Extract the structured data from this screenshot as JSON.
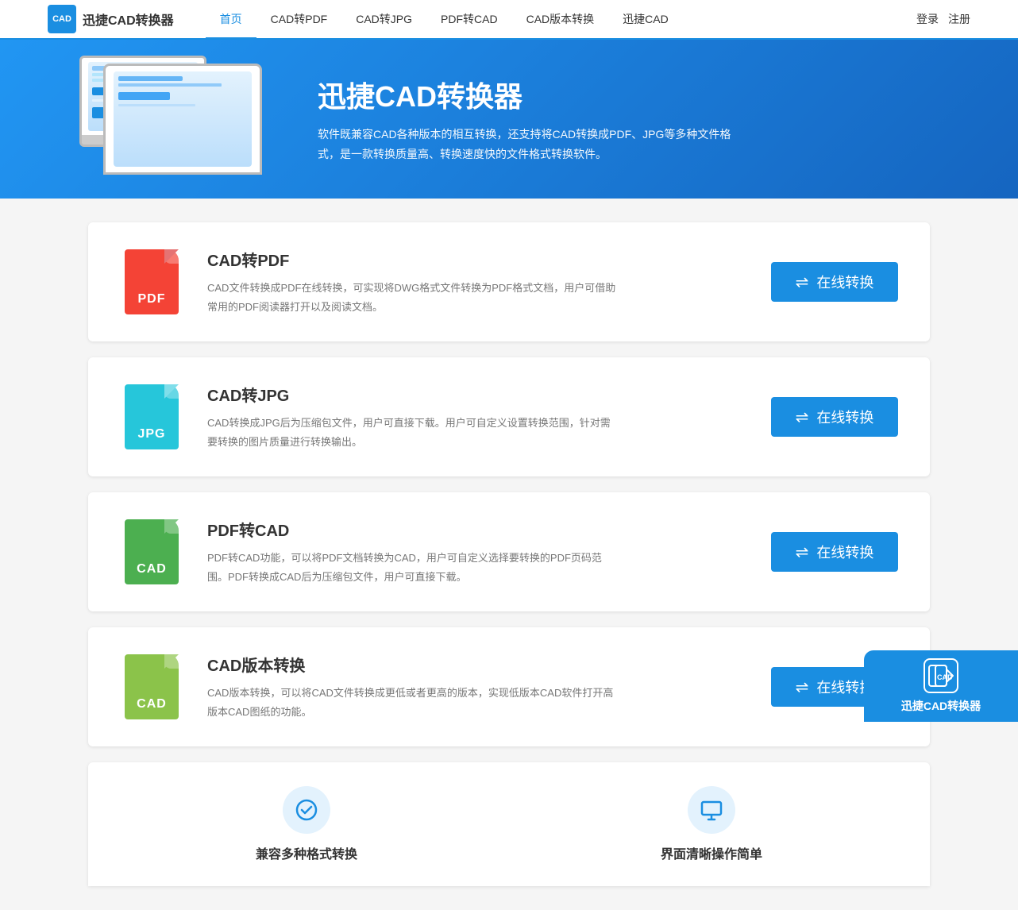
{
  "nav": {
    "logo_icon": "CAD",
    "logo_text": "迅捷CAD转换器",
    "items": [
      {
        "label": "首页",
        "active": true
      },
      {
        "label": "CAD转PDF",
        "active": false
      },
      {
        "label": "CAD转JPG",
        "active": false
      },
      {
        "label": "PDF转CAD",
        "active": false
      },
      {
        "label": "CAD版本转换",
        "active": false
      },
      {
        "label": "迅捷CAD",
        "active": false
      }
    ],
    "login": "登录",
    "register": "注册"
  },
  "hero": {
    "title": "迅捷CAD转换器",
    "desc": "软件既兼容CAD各种版本的相互转换，还支持将CAD转换成PDF、JPG等多种文件格式，是一款转换质量高、转换速度快的文件格式转换软件。"
  },
  "cards": [
    {
      "id": "cad-to-pdf",
      "icon_label": "PDF",
      "icon_type": "pdf",
      "title": "CAD转PDF",
      "desc": "CAD文件转换成PDF在线转换，可实现将DWG格式文件转换为PDF格式文档，用户可借助常用的PDF阅读器打开以及阅读文档。",
      "btn_label": "在线转换"
    },
    {
      "id": "cad-to-jpg",
      "icon_label": "JPG",
      "icon_type": "jpg",
      "title": "CAD转JPG",
      "desc": "CAD转换成JPG后为压缩包文件，用户可直接下载。用户可自定义设置转换范围，针对需要转换的图片质量进行转换输出。",
      "btn_label": "在线转换"
    },
    {
      "id": "pdf-to-cad",
      "icon_label": "CAD",
      "icon_type": "cad-green",
      "title": "PDF转CAD",
      "desc": "PDF转CAD功能，可以将PDF文档转换为CAD，用户可自定义选择要转换的PDF页码范围。PDF转换成CAD后为压缩包文件，用户可直接下载。",
      "btn_label": "在线转换"
    },
    {
      "id": "cad-version",
      "icon_label": "CAD",
      "icon_type": "cad-lime",
      "title": "CAD版本转换",
      "desc": "CAD版本转换，可以将CAD文件转换成更低或者更高的版本，实现低版本CAD软件打开高版本CAD图纸的功能。",
      "btn_label": "在线转换"
    }
  ],
  "features": [
    {
      "label": "兼容多种格式转换",
      "icon": "🔄"
    },
    {
      "label": "界面清晰操作简单",
      "icon": "🖥️"
    }
  ],
  "float_btn": {
    "icon_text": "CAD",
    "label": "迅捷CAD转换器"
  }
}
